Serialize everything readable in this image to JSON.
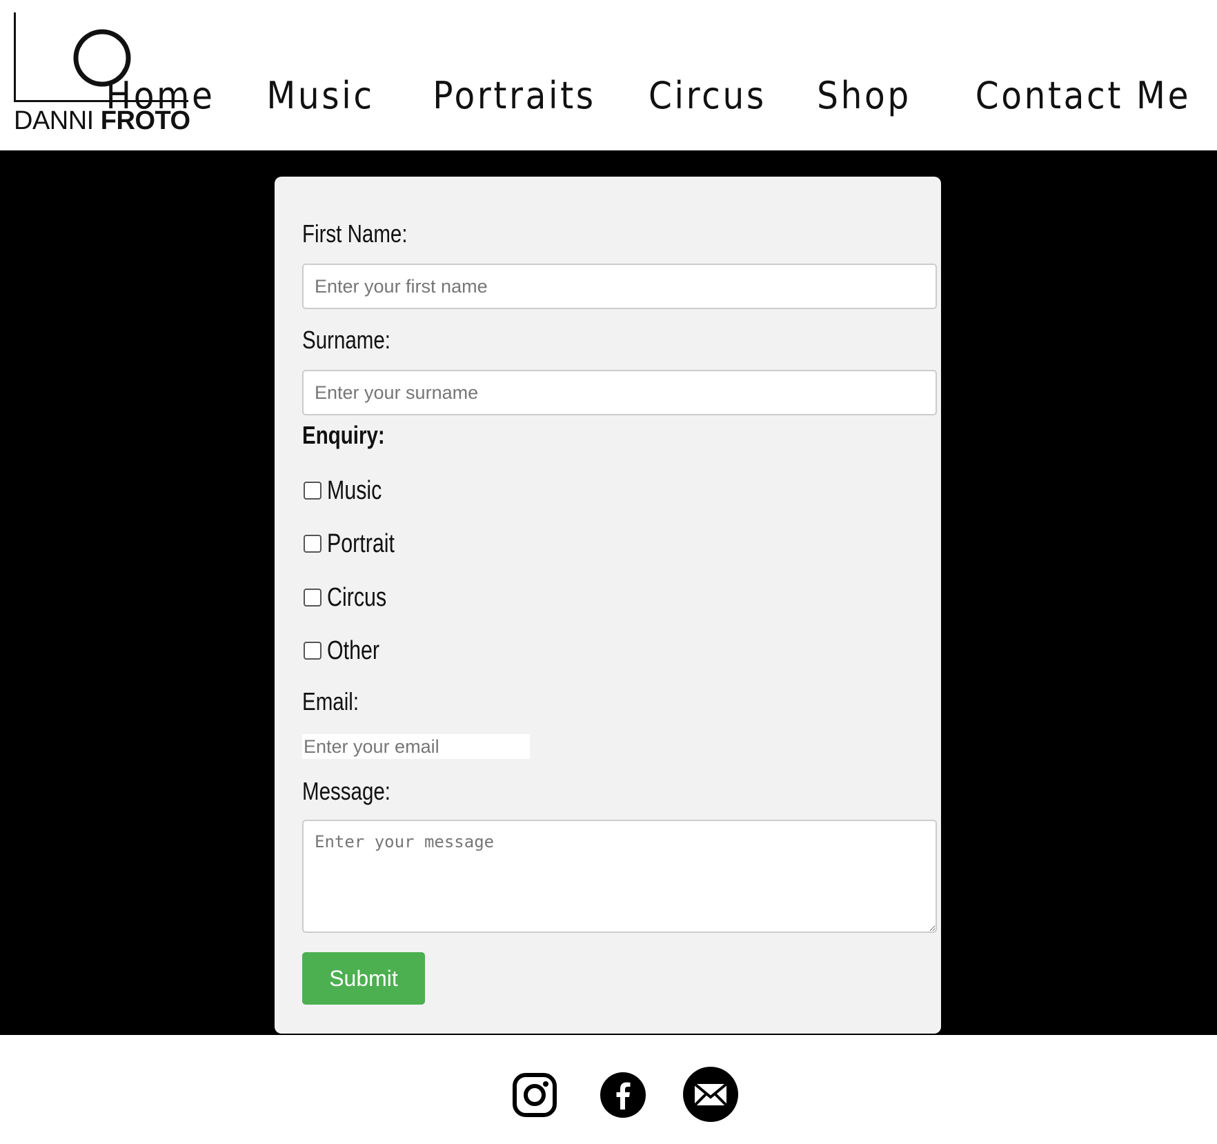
{
  "header": {
    "logo": {
      "text_light": "DANNI",
      "text_bold": "FROTO"
    },
    "nav": [
      {
        "label": "Home"
      },
      {
        "label": "Music"
      },
      {
        "label": "Portraits"
      },
      {
        "label": "Circus"
      },
      {
        "label": "Shop"
      },
      {
        "label": "Contact Me"
      }
    ]
  },
  "form": {
    "first_name": {
      "label": "First Name:",
      "placeholder": "Enter your first name",
      "value": ""
    },
    "surname": {
      "label": "Surname:",
      "placeholder": "Enter your surname",
      "value": ""
    },
    "enquiry": {
      "label": "Enquiry:",
      "options": [
        {
          "label": "Music",
          "checked": false
        },
        {
          "label": "Portrait",
          "checked": false
        },
        {
          "label": "Circus",
          "checked": false
        },
        {
          "label": "Other",
          "checked": false
        }
      ]
    },
    "email": {
      "label": "Email:",
      "placeholder": "Enter your email",
      "value": ""
    },
    "message": {
      "label": "Message:",
      "placeholder": "Enter your message",
      "value": ""
    },
    "submit_label": "Submit"
  },
  "footer": {
    "icons": [
      "instagram-icon",
      "facebook-icon",
      "email-icon"
    ]
  },
  "colors": {
    "page_background": "#000000",
    "form_background": "#f2f2f2",
    "submit_button": "#4caf50",
    "header_background": "#ffffff"
  }
}
